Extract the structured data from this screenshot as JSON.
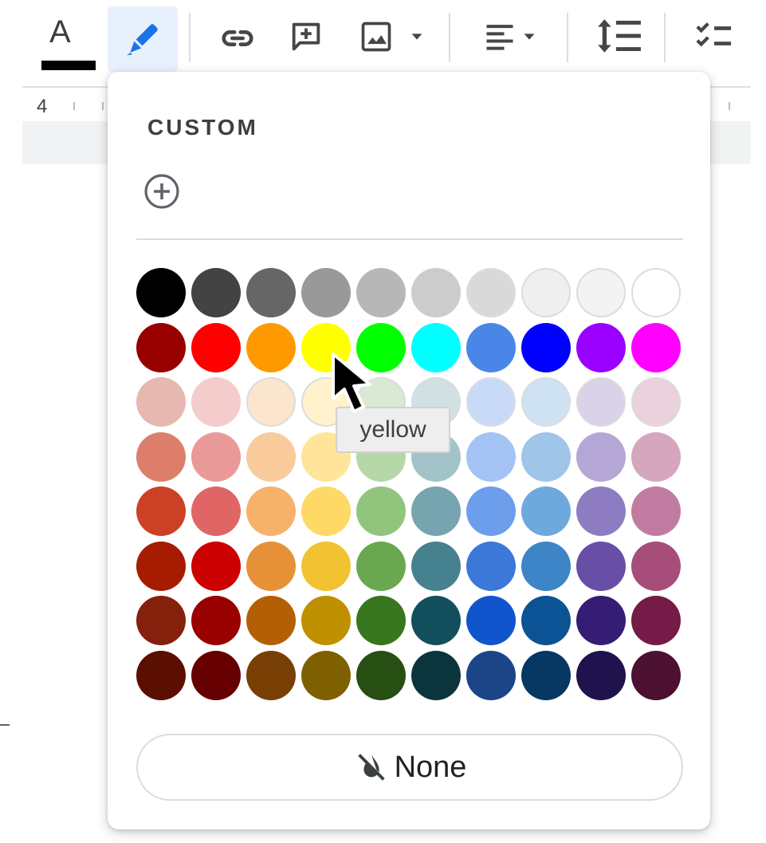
{
  "toolbar": {
    "text_color_glyph": "A",
    "text_color_value": "#000000",
    "icons": [
      "text-color-icon",
      "highlight-pen-icon",
      "link-icon",
      "add-comment-icon",
      "image-icon",
      "align-icon",
      "line-spacing-icon",
      "checklist-icon"
    ]
  },
  "ruler": {
    "number": "4"
  },
  "palette": {
    "custom_heading": "CUSTOM",
    "add_custom_icon": "add-circle-icon",
    "rows": [
      [
        "#000000",
        "#434343",
        "#666666",
        "#999999",
        "#b7b7b7",
        "#cccccc",
        "#d9d9d9",
        "#efefef",
        "#f3f3f3",
        "#ffffff"
      ],
      [
        "#980000",
        "#ff0000",
        "#ff9900",
        "#ffff00",
        "#00ff00",
        "#00ffff",
        "#4a86e8",
        "#0000ff",
        "#9900ff",
        "#ff00ff"
      ],
      [
        "#e6b8af",
        "#f4cccc",
        "#fce5cd",
        "#fff2cc",
        "#d9ead3",
        "#d0e0e3",
        "#c9daf8",
        "#cfe2f3",
        "#d9d2e9",
        "#ead1dc"
      ],
      [
        "#dd7e6b",
        "#ea9999",
        "#f9cb9c",
        "#ffe599",
        "#b6d7a8",
        "#a2c4c9",
        "#a4c2f4",
        "#9fc5e8",
        "#b4a7d6",
        "#d5a6bd"
      ],
      [
        "#cc4125",
        "#e06666",
        "#f6b26b",
        "#ffd966",
        "#93c47d",
        "#76a5af",
        "#6d9eeb",
        "#6fa8dc",
        "#8e7cc3",
        "#c27ba0"
      ],
      [
        "#a61c00",
        "#cc0000",
        "#e69138",
        "#f1c232",
        "#6aa84f",
        "#45818e",
        "#3c78d8",
        "#3d85c6",
        "#674ea7",
        "#a64d79"
      ],
      [
        "#85200c",
        "#990000",
        "#b45f06",
        "#bf9000",
        "#38761d",
        "#134f5c",
        "#1155cc",
        "#0b5394",
        "#351c75",
        "#741b47"
      ],
      [
        "#5b0f00",
        "#660000",
        "#783f04",
        "#7f6000",
        "#274e13",
        "#0c343d",
        "#1c4587",
        "#073763",
        "#20124d",
        "#4c1130"
      ]
    ],
    "none_label": "None",
    "none_icon": "format-color-reset-icon"
  },
  "tooltip": {
    "text": "yellow"
  },
  "accent": "#e8f0fe"
}
